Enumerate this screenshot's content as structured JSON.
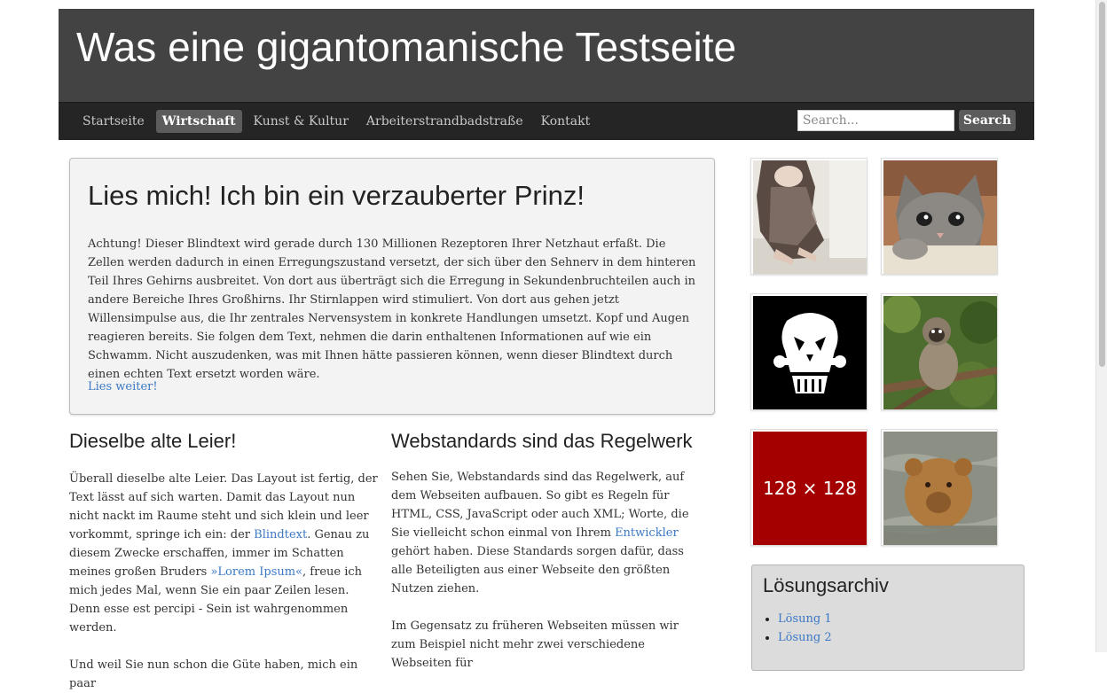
{
  "site": {
    "title": "Was eine gigantomanische Testseite"
  },
  "nav": {
    "items": [
      {
        "label": "Startseite"
      },
      {
        "label": "Wirtschaft"
      },
      {
        "label": "Kunst & Kultur"
      },
      {
        "label": "Arbeiterstrandbadstraße"
      },
      {
        "label": "Kontakt"
      }
    ],
    "active_index": 1
  },
  "search": {
    "placeholder": "Search...",
    "button_label": "Search"
  },
  "hero": {
    "title": "Lies mich! Ich bin ein verzauberter Prinz!",
    "text": "Achtung! Dieser Blindtext wird gerade durch 130 Millionen Rezeptoren Ihrer Netzhaut erfaßt. Die Zellen werden dadurch in einen Erregungszustand versetzt, der sich über den Sehnerv in dem hinteren Teil Ihres Gehirns ausbreitet. Von dort aus überträgt sich die Erregung in Sekundenbruchteilen auch in andere Bereiche Ihres Großhirns. Ihr Stirnlappen wird stimuliert. Von dort aus gehen jetzt Willensimpulse aus, die Ihr zentrales Nervensystem in konkrete Handlungen umsetzt. Kopf und Augen reagieren bereits. Sie folgen dem Text, nehmen die darin enthaltenen Informationen auf wie ein Schwamm. Nicht auszudenken, was mit Ihnen hätte passieren können, wenn dieser Blindtext durch einen echten Text ersetzt worden wäre.",
    "more_link": "Lies weiter!"
  },
  "left_col": {
    "title": "Dieselbe alte Leier!",
    "p1_a": "Überall dieselbe alte Leier. Das Layout ist fertig, der Text lässt auf sich warten. Damit das Layout nun nicht nackt im Raume steht und sich klein und leer vorkommt, springe ich ein: der ",
    "p1_link1": "Blindtext",
    "p1_b": ". Genau zu diesem Zwecke erschaffen, immer im Schatten meines großen Bruders ",
    "p1_link2": "»Lorem Ipsum«",
    "p1_c": ", freue ich mich jedes Mal, wenn Sie ein paar Zeilen lesen. Denn esse est percipi - Sein ist wahrgenommen werden.",
    "p2": "Und weil Sie nun schon die Güte haben, mich ein paar"
  },
  "right_col": {
    "title": "Webstandards sind das Regelwerk",
    "p1_a": "Sehen Sie, Webstandards sind das Regelwerk, auf dem Webseiten aufbauen. So gibt es Regeln für HTML, CSS, JavaScript oder auch XML; Worte, die Sie vielleicht schon einmal von Ihrem ",
    "p1_link": "Entwickler",
    "p1_b": " gehört haben. Diese Standards sorgen dafür, dass alle Beteiligten aus einer Webseite den größten Nutzen ziehen.",
    "p2": "Im Gegensatz zu früheren Webseiten müssen wir zum Beispiel nicht mehr zwei verschiedene Webseiten für"
  },
  "thumbs": {
    "placeholder_label": "128 × 128",
    "placeholder_color": "#a40000"
  },
  "archive": {
    "title": "Lösungsarchiv",
    "items": [
      {
        "label": "Lösung 1"
      },
      {
        "label": "Lösung 2"
      }
    ]
  },
  "colors": {
    "masthead": "#434343",
    "navbar": "#252525",
    "link": "#3b78c5"
  }
}
